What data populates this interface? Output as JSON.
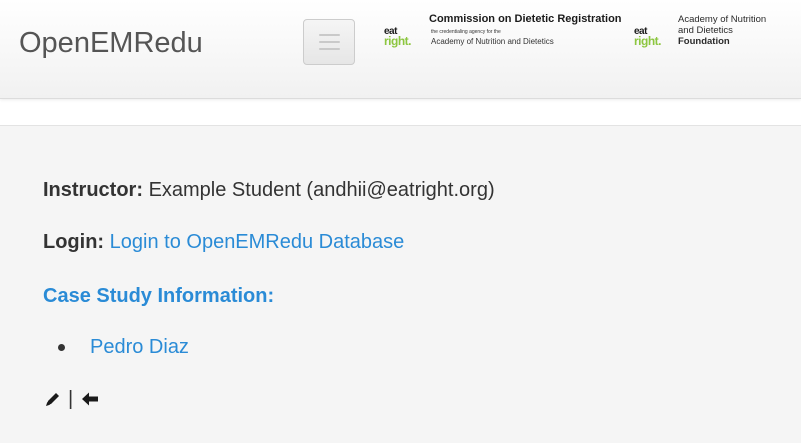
{
  "navbar": {
    "brand": "OpenEMRedu",
    "toggle_icon": "hamburger-icon",
    "logo_cdr": {
      "title": "Commission on Dietetic Registration",
      "tagline": "the credentialing agency for the",
      "subtitle": "Academy of Nutrition and Dietetics",
      "mark_top": "eat",
      "mark_bottom": "right."
    },
    "logo_foundation": {
      "line1": "Academy of Nutrition",
      "line2": "and Dietetics",
      "line3": "Foundation",
      "mark_top": "eat",
      "mark_bottom": "right."
    }
  },
  "content": {
    "instructor_label": "Instructor:",
    "instructor_value": "Example Student (andhii@eatright.org)",
    "login_label": "Login:",
    "login_link": "Login to OpenEMRedu Database",
    "case_heading": "Case Study Information:",
    "cases": [
      "Pedro Diaz"
    ],
    "separator": "|",
    "actions": {
      "edit_icon": "pencil-icon",
      "back_icon": "arrow-left-icon"
    }
  },
  "colors": {
    "link": "#2a8bd6",
    "eatright_green": "#8cc63f",
    "well_bg": "#f5f5f5"
  }
}
